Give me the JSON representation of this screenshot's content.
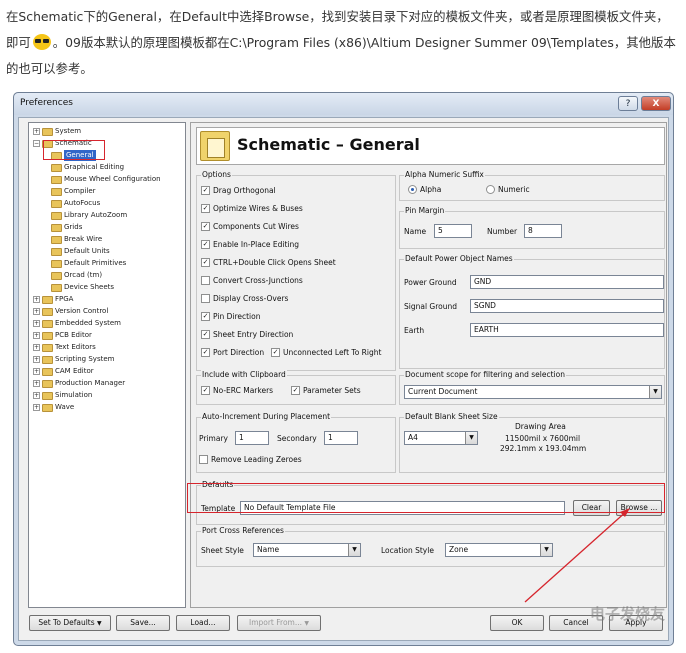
{
  "intro": {
    "line1": "在Schematic下的General，在Default中选择Browse，找到安装目录下对应的模板文件夹，或者是原理图模板文件夹，",
    "line2_a": "即可",
    "line2_b": "。09版本默认的原理图模板都在C:\\Program Files (x86)\\Altium Designer Summer 09\\Templates，其他版本",
    "line3": "的也可以参考。"
  },
  "window": {
    "title": "Preferences",
    "help": "?",
    "close": "X"
  },
  "tree": [
    {
      "label": "System",
      "expander": "+"
    },
    {
      "label": "Schematic",
      "expander": "−"
    },
    {
      "label": "General",
      "expander": ""
    },
    {
      "label": "Graphical Editing",
      "expander": ""
    },
    {
      "label": "Mouse Wheel Configuration",
      "expander": ""
    },
    {
      "label": "Compiler",
      "expander": ""
    },
    {
      "label": "AutoFocus",
      "expander": ""
    },
    {
      "label": "Library AutoZoom",
      "expander": ""
    },
    {
      "label": "Grids",
      "expander": ""
    },
    {
      "label": "Break Wire",
      "expander": ""
    },
    {
      "label": "Default Units",
      "expander": ""
    },
    {
      "label": "Default Primitives",
      "expander": ""
    },
    {
      "label": "Orcad (tm)",
      "expander": ""
    },
    {
      "label": "Device Sheets",
      "expander": ""
    },
    {
      "label": "FPGA",
      "expander": "+"
    },
    {
      "label": "Version Control",
      "expander": "+"
    },
    {
      "label": "Embedded System",
      "expander": "+"
    },
    {
      "label": "PCB Editor",
      "expander": "+"
    },
    {
      "label": "Text Editors",
      "expander": "+"
    },
    {
      "label": "Scripting System",
      "expander": "+"
    },
    {
      "label": "CAM Editor",
      "expander": "+"
    },
    {
      "label": "Production Manager",
      "expander": "+"
    },
    {
      "label": "Simulation",
      "expander": "+"
    },
    {
      "label": "Wave",
      "expander": "+"
    }
  ],
  "header": {
    "title": "Schematic – General"
  },
  "options": {
    "title": "Options",
    "items": [
      {
        "label": "Drag Orthogonal",
        "checked": true
      },
      {
        "label": "Optimize Wires & Buses",
        "checked": true
      },
      {
        "label": "Components Cut Wires",
        "checked": true
      },
      {
        "label": "Enable In-Place Editing",
        "checked": true
      },
      {
        "label": "CTRL+Double Click Opens Sheet",
        "checked": true
      },
      {
        "label": "Convert Cross-Junctions",
        "checked": false
      },
      {
        "label": "Display Cross-Overs",
        "checked": false
      },
      {
        "label": "Pin Direction",
        "checked": true
      },
      {
        "label": "Sheet Entry Direction",
        "checked": true
      },
      {
        "label": "Port Direction",
        "checked": true
      },
      {
        "label": "Unconnected Left To Right",
        "checked": true
      }
    ]
  },
  "alpha": {
    "title": "Alpha Numeric Suffix",
    "alpha": "Alpha",
    "numeric": "Numeric"
  },
  "pin_margin": {
    "title": "Pin Margin",
    "name_label": "Name",
    "name_value": "5",
    "number_label": "Number",
    "number_value": "8"
  },
  "power": {
    "title": "Default Power Object Names",
    "ground_label": "Power Ground",
    "ground_value": "GND",
    "signal_label": "Signal Ground",
    "signal_value": "SGND",
    "earth_label": "Earth",
    "earth_value": "EARTH"
  },
  "clipboard": {
    "title": "Include with Clipboard",
    "no_erc": "No-ERC Markers",
    "params": "Parameter Sets"
  },
  "scope": {
    "title": "Document scope for filtering and selection",
    "value": "Current Document"
  },
  "autoinc": {
    "title": "Auto-Increment During Placement",
    "primary_label": "Primary",
    "primary_value": "1",
    "secondary_label": "Secondary",
    "secondary_value": "1",
    "remove": "Remove Leading Zeroes"
  },
  "blank_sheet": {
    "title": "Default Blank Sheet Size",
    "value": "A4",
    "drawing_area_label": "Drawing Area",
    "dim1": "11500mil x 7600mil",
    "dim2": "292.1mm x 193.04mm"
  },
  "defaults": {
    "title": "Defaults",
    "template_label": "Template",
    "template_value": "No Default Template File",
    "clear": "Clear",
    "browse": "Browse ..."
  },
  "port_cross": {
    "title": "Port Cross References",
    "sheet_style_label": "Sheet Style",
    "sheet_style_value": "Name",
    "location_style_label": "Location Style",
    "location_style_value": "Zone"
  },
  "footer": {
    "set_defaults": "Set To Defaults",
    "save": "Save...",
    "load": "Load...",
    "import": "Import From...",
    "ok": "OK",
    "cancel": "Cancel",
    "apply": "Apply"
  },
  "watermark": "电子发烧友",
  "colors": {
    "highlight": "#d6252d",
    "selection": "#3166c8"
  }
}
